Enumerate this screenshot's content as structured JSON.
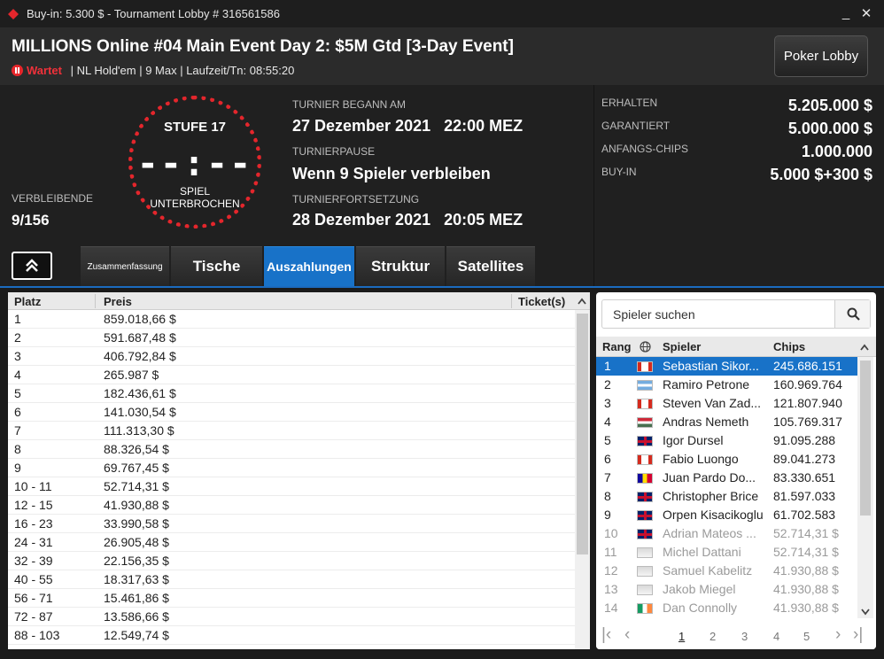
{
  "window": {
    "title": "Buy-in: 5.300 $ - Tournament Lobby # 316561586",
    "minimize": "_",
    "close": "✕"
  },
  "header": {
    "title": "MILLIONS Online #04 Main Event Day 2: $5M Gtd [3-Day Event]",
    "status": "Wartet",
    "details": " | NL Hold'em | 9 Max | Laufzeit/Tn: 08:55:20",
    "lobby_button": "Poker Lobby"
  },
  "clock": {
    "level": "STUFE 17",
    "time": "--:--",
    "state": "SPIEL\nUNTERBROCHEN"
  },
  "remaining": {
    "label": "VERBLEIBENDE",
    "value": "9/156"
  },
  "tournament": {
    "started_label": "TURNIER BEGANN AM",
    "started_value": "27 Dezember 2021   22:00 MEZ",
    "pause_label": "TURNIERPAUSE",
    "pause_value": "Wenn 9 Spieler verbleiben",
    "resume_label": "TURNIERFORTSETZUNG",
    "resume_value": "28 Dezember 2021   20:05 MEZ"
  },
  "prize": [
    {
      "label": "ERHALTEN",
      "value": "5.205.000 $"
    },
    {
      "label": "GARANTIERT",
      "value": "5.000.000 $"
    },
    {
      "label": "ANFANGS-CHIPS",
      "value": "1.000.000"
    },
    {
      "label": "BUY-IN",
      "value": "5.000 $+300 $"
    }
  ],
  "tabs": [
    "Zusammenfassung",
    "Tische",
    "Auszahlungen",
    "Struktur",
    "Satellites"
  ],
  "payout": {
    "columns": [
      "Platz",
      "Preis",
      "Ticket(s)"
    ],
    "rows": [
      [
        "1",
        "859.018,66 $"
      ],
      [
        "2",
        "591.687,48 $"
      ],
      [
        "3",
        "406.792,84 $"
      ],
      [
        "4",
        "265.987 $"
      ],
      [
        "5",
        "182.436,61 $"
      ],
      [
        "6",
        "141.030,54 $"
      ],
      [
        "7",
        "111.313,30 $"
      ],
      [
        "8",
        "88.326,54 $"
      ],
      [
        "9",
        "69.767,45 $"
      ],
      [
        "10 - 11",
        "52.714,31 $"
      ],
      [
        "12 - 15",
        "41.930,88 $"
      ],
      [
        "16 - 23",
        "33.990,58 $"
      ],
      [
        "24 - 31",
        "26.905,48 $"
      ],
      [
        "32 - 39",
        "22.156,35 $"
      ],
      [
        "40 - 55",
        "18.317,63 $"
      ],
      [
        "56 - 71",
        "15.461,86 $"
      ],
      [
        "72 - 87",
        "13.586,66 $"
      ],
      [
        "88 - 103",
        "12.549,74 $"
      ]
    ]
  },
  "players": {
    "search_placeholder": "Spieler suchen",
    "columns": [
      "Rang",
      "Spieler",
      "Chips"
    ],
    "rows": [
      {
        "rank": "1",
        "name": "Sebastian Sikor...",
        "chips": "245.686.151",
        "flag": "CA"
      },
      {
        "rank": "2",
        "name": "Ramiro Petrone",
        "chips": "160.969.764",
        "flag": "AR"
      },
      {
        "rank": "3",
        "name": "Steven Van Zad...",
        "chips": "121.807.940",
        "flag": "CA"
      },
      {
        "rank": "4",
        "name": "Andras Nemeth",
        "chips": "105.769.317",
        "flag": "HU"
      },
      {
        "rank": "5",
        "name": "Igor Dursel",
        "chips": "91.095.288",
        "flag": "GB"
      },
      {
        "rank": "6",
        "name": "Fabio Luongo",
        "chips": "89.041.273",
        "flag": "CA"
      },
      {
        "rank": "7",
        "name": "Juan Pardo Do...",
        "chips": "83.330.651",
        "flag": "AD"
      },
      {
        "rank": "8",
        "name": "Christopher Brice",
        "chips": "81.597.033",
        "flag": "GB"
      },
      {
        "rank": "9",
        "name": "Orpen Kisacikoglu",
        "chips": "61.702.583",
        "flag": "GB"
      },
      {
        "rank": "10",
        "name": "Adrian Mateos ...",
        "chips": "52.714,31 $",
        "flag": "GB"
      },
      {
        "rank": "11",
        "name": "Michel Dattani",
        "chips": "52.714,31 $",
        "flag": "XX"
      },
      {
        "rank": "12",
        "name": "Samuel Kabelitz",
        "chips": "41.930,88 $",
        "flag": "XX"
      },
      {
        "rank": "13",
        "name": "Jakob Miegel",
        "chips": "41.930,88 $",
        "flag": "XX"
      },
      {
        "rank": "14",
        "name": "Dan Connolly",
        "chips": "41.930,88 $",
        "flag": "IE"
      }
    ],
    "pages": [
      "1",
      "2",
      "3",
      "4",
      "5"
    ]
  }
}
